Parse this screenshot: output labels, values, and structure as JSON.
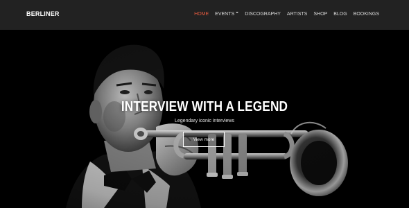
{
  "brand": {
    "name": "BERLINER"
  },
  "nav": {
    "items": [
      {
        "label": "HOME",
        "active": true,
        "has_dropdown": false
      },
      {
        "label": "EVENTS",
        "active": false,
        "has_dropdown": true
      },
      {
        "label": "DISCOGRAPHY",
        "active": false,
        "has_dropdown": false
      },
      {
        "label": "ARTISTS",
        "active": false,
        "has_dropdown": false
      },
      {
        "label": "SHOP",
        "active": false,
        "has_dropdown": false
      },
      {
        "label": "BLOG",
        "active": false,
        "has_dropdown": false
      },
      {
        "label": "BOOKINGS",
        "active": false,
        "has_dropdown": false
      }
    ]
  },
  "hero": {
    "title": "INTERVIEW WITH A LEGEND",
    "subtitle": "Legendary iconic interviews",
    "button_label": "View more",
    "image": "black-and-white-trumpet-player-icon"
  },
  "colors": {
    "navbar_bg": "#222222",
    "accent": "#e05a3f",
    "nav_text": "#d8d8d8",
    "hero_bg": "#000000"
  }
}
